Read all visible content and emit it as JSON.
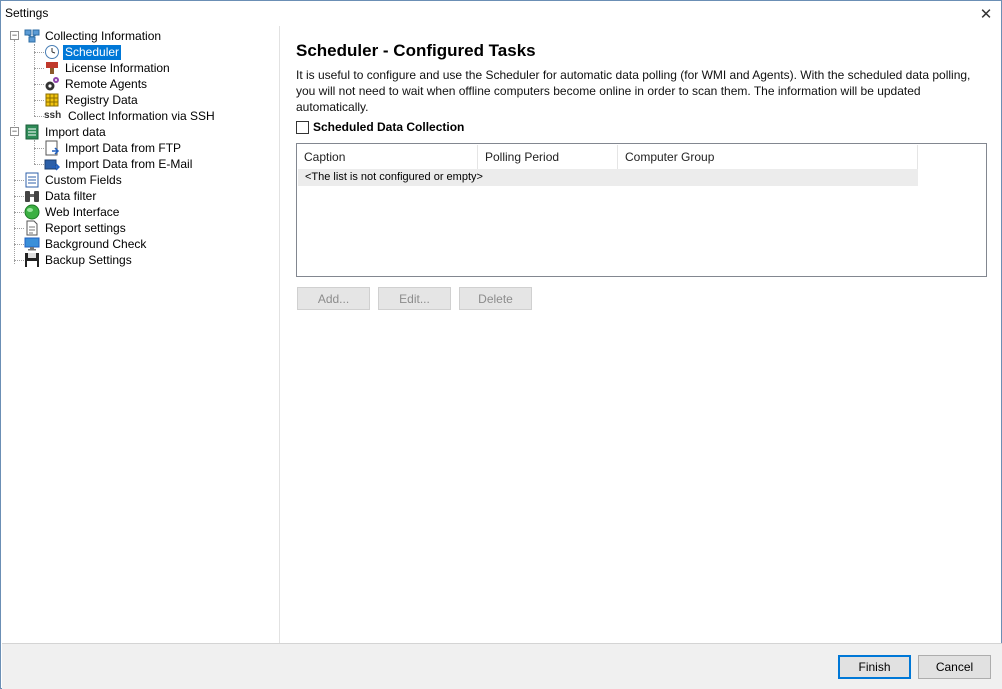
{
  "window": {
    "title": "Settings",
    "close_glyph": "✕"
  },
  "tree": {
    "items": [
      {
        "label": "Collecting Information",
        "icon": "network-computers-icon"
      },
      {
        "label": "Scheduler",
        "icon": "clock-icon",
        "selected": true
      },
      {
        "label": "License Information",
        "icon": "license-stamp-icon"
      },
      {
        "label": "Remote Agents",
        "icon": "gears-icon"
      },
      {
        "label": "Registry Data",
        "icon": "registry-grid-icon"
      },
      {
        "label": "Collect Information via SSH",
        "icon": "ssh-icon",
        "icon_text": "ssh"
      },
      {
        "label": "Import data",
        "icon": "import-data-icon"
      },
      {
        "label": "Import Data from FTP",
        "icon": "ftp-import-icon"
      },
      {
        "label": "Import Data from E-Mail",
        "icon": "email-import-icon"
      },
      {
        "label": "Custom Fields",
        "icon": "list-document-icon"
      },
      {
        "label": "Data filter",
        "icon": "binoculars-icon"
      },
      {
        "label": "Web Interface",
        "icon": "globe-icon"
      },
      {
        "label": "Report settings",
        "icon": "report-document-icon"
      },
      {
        "label": "Background Check",
        "icon": "monitor-icon"
      },
      {
        "label": "Backup Settings",
        "icon": "floppy-disk-icon"
      }
    ]
  },
  "main": {
    "heading": "Scheduler - Configured Tasks",
    "description": "It is useful to configure and use the Scheduler for automatic data polling (for WMI and Agents). With the scheduled data polling, you will not need to wait when offline computers become online in order to scan them. The information will be updated automatically.",
    "checkbox_label": "Scheduled Data Collection",
    "checkbox_checked": false,
    "columns": [
      "Caption",
      "Polling Period",
      "Computer Group"
    ],
    "empty_text": "<The list is not configured or empty>",
    "buttons": {
      "add": "Add...",
      "edit": "Edit...",
      "delete": "Delete"
    }
  },
  "footer": {
    "finish": "Finish",
    "cancel": "Cancel"
  },
  "colors": {
    "selection": "#0078d7",
    "default_button_border": "#0078d7"
  }
}
